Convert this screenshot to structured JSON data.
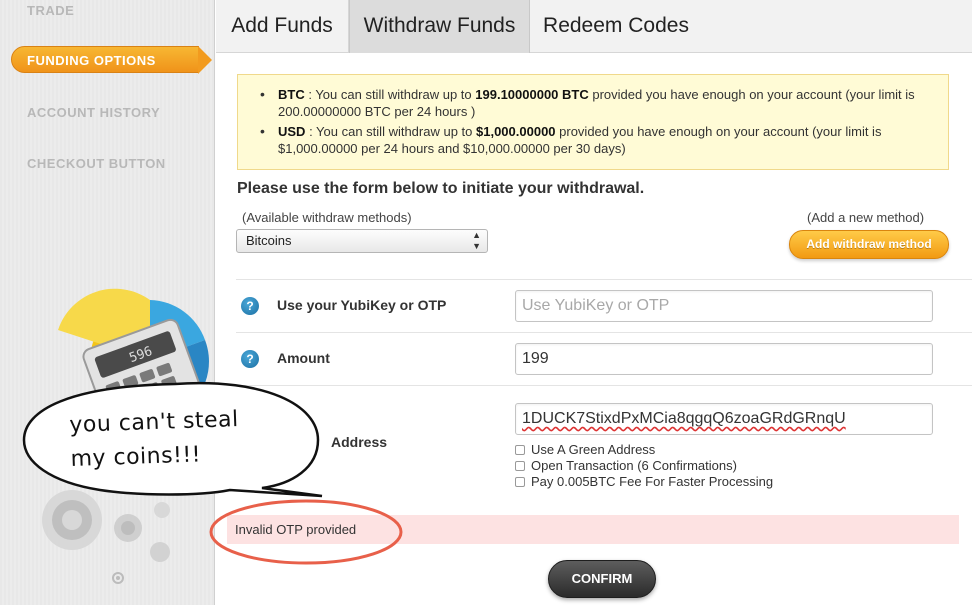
{
  "sidebar": {
    "items": [
      {
        "label": "TRADE"
      },
      {
        "label": "FUNDING OPTIONS"
      },
      {
        "label": "ACCOUNT HISTORY"
      },
      {
        "label": "CHECKOUT BUTTON"
      }
    ],
    "calculator_display": "596"
  },
  "tabs": [
    {
      "label": "Add Funds"
    },
    {
      "label": "Withdraw Funds",
      "active": true
    },
    {
      "label": "Redeem Codes"
    }
  ],
  "notice": {
    "btc_currency": "BTC",
    "btc_pre": " : You can still withdraw up to ",
    "btc_amount": "199.10000000 BTC",
    "btc_post": " provided you have enough on your account (your limit is 200.00000000 BTC per 24 hours )",
    "usd_currency": "USD",
    "usd_pre": " : You can still withdraw up to ",
    "usd_amount": "$1,000.00000",
    "usd_post": " provided you have enough on your account (your limit is $1,000.00000 per 24 hours and $10,000.00000 per 30 days)"
  },
  "form": {
    "title": "Please use the form below to initiate your withdrawal.",
    "methods_label": "(Available withdraw methods)",
    "add_method_label": "(Add a new method)",
    "selected_method": "Bitcoins",
    "add_button": "Add withdraw method",
    "otp_label": "Use your YubiKey or OTP",
    "otp_placeholder": "Use YubiKey or OTP",
    "amount_label": "Amount",
    "amount_value": "199",
    "address_label": "Address",
    "address_value": "1DUCK7StixdPxMCia8qgqQ6zoaGRdGRnqU",
    "options": [
      {
        "label": "Use A Green Address"
      },
      {
        "label": "Open Transaction (6 Confirmations)"
      },
      {
        "label": "Pay 0.005BTC Fee For Faster Processing"
      }
    ],
    "error": "Invalid OTP provided",
    "confirm_button": "CONFIRM"
  },
  "annotation": {
    "line1": "you can't steal",
    "line2": "my coins!!!"
  },
  "colors": {
    "accent": "#f29a12",
    "error_bg": "#fde2e2",
    "notice_bg": "#fffbd6",
    "annotation_red": "#e8604a"
  }
}
